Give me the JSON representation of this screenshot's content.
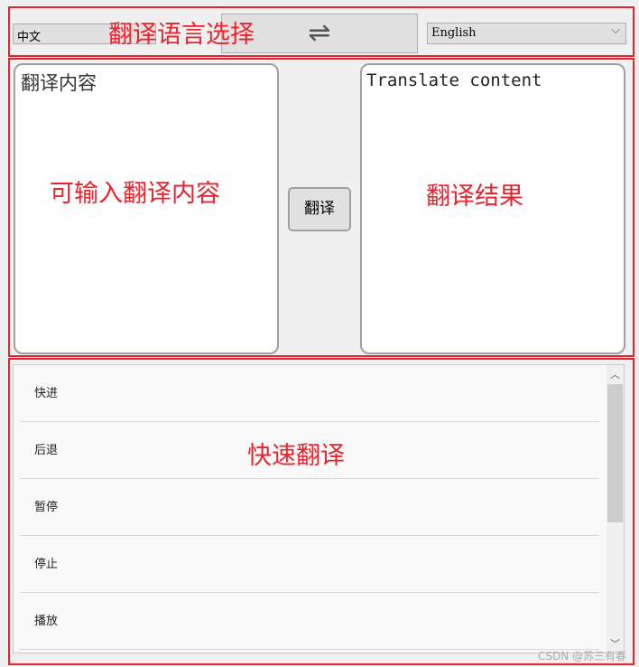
{
  "language_bar": {
    "source_lang": "中文",
    "target_lang": "English",
    "swap_icon": "⇌"
  },
  "input": {
    "value": "翻译内容"
  },
  "output": {
    "value": "Translate content"
  },
  "translate_button": "翻译",
  "quick_list": {
    "items": [
      "快进",
      "后退",
      "暂停",
      "停止",
      "播放"
    ]
  },
  "annotations": {
    "lang": "翻译语言选择",
    "input": "可输入翻译内容",
    "output": "翻译结果",
    "quick": "快速翻译"
  },
  "watermark": "CSDN @苏三有春",
  "colors": {
    "annotation": "#e8232e"
  }
}
